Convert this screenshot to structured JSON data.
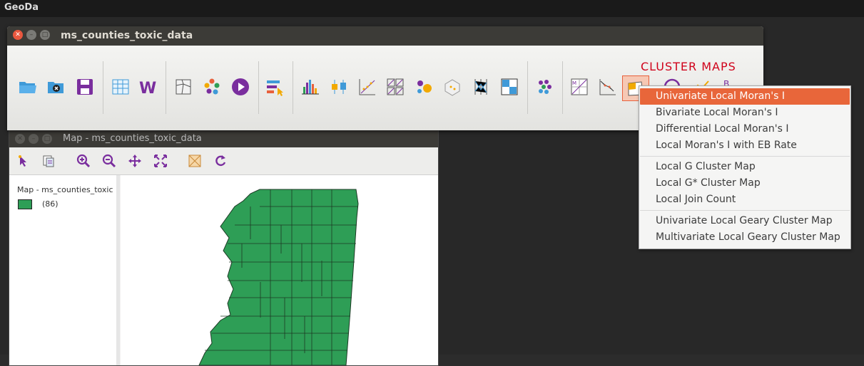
{
  "desktop": {
    "app_name": "GeoDa"
  },
  "main_window": {
    "title": "ms_counties_toxic_data",
    "toolbar": {
      "cluster_label": "CLUSTER MAPS"
    }
  },
  "map_window": {
    "title": "Map - ms_counties_toxic_data",
    "legend": {
      "title": "Map - ms_counties_toxic",
      "category_count": "(86)",
      "category_color": "#2e9e56"
    }
  },
  "cluster_menu": {
    "items": [
      {
        "label": "Univariate Local Moran's I",
        "selected": true
      },
      {
        "label": "Bivariate Local Moran's I"
      },
      {
        "label": "Differential Local Moran's I"
      },
      {
        "label": "Local Moran's I with EB Rate"
      },
      {
        "label": "Local G Cluster Map"
      },
      {
        "label": "Local G* Cluster Map"
      },
      {
        "label": "Local Join Count"
      },
      {
        "label": "Univariate Local Geary Cluster Map"
      },
      {
        "label": "Multivariate Local Geary Cluster Map"
      }
    ]
  },
  "colors": {
    "accent": "#e8663a",
    "map_fill": "#2e9e56",
    "cluster_label": "#d0021b"
  }
}
